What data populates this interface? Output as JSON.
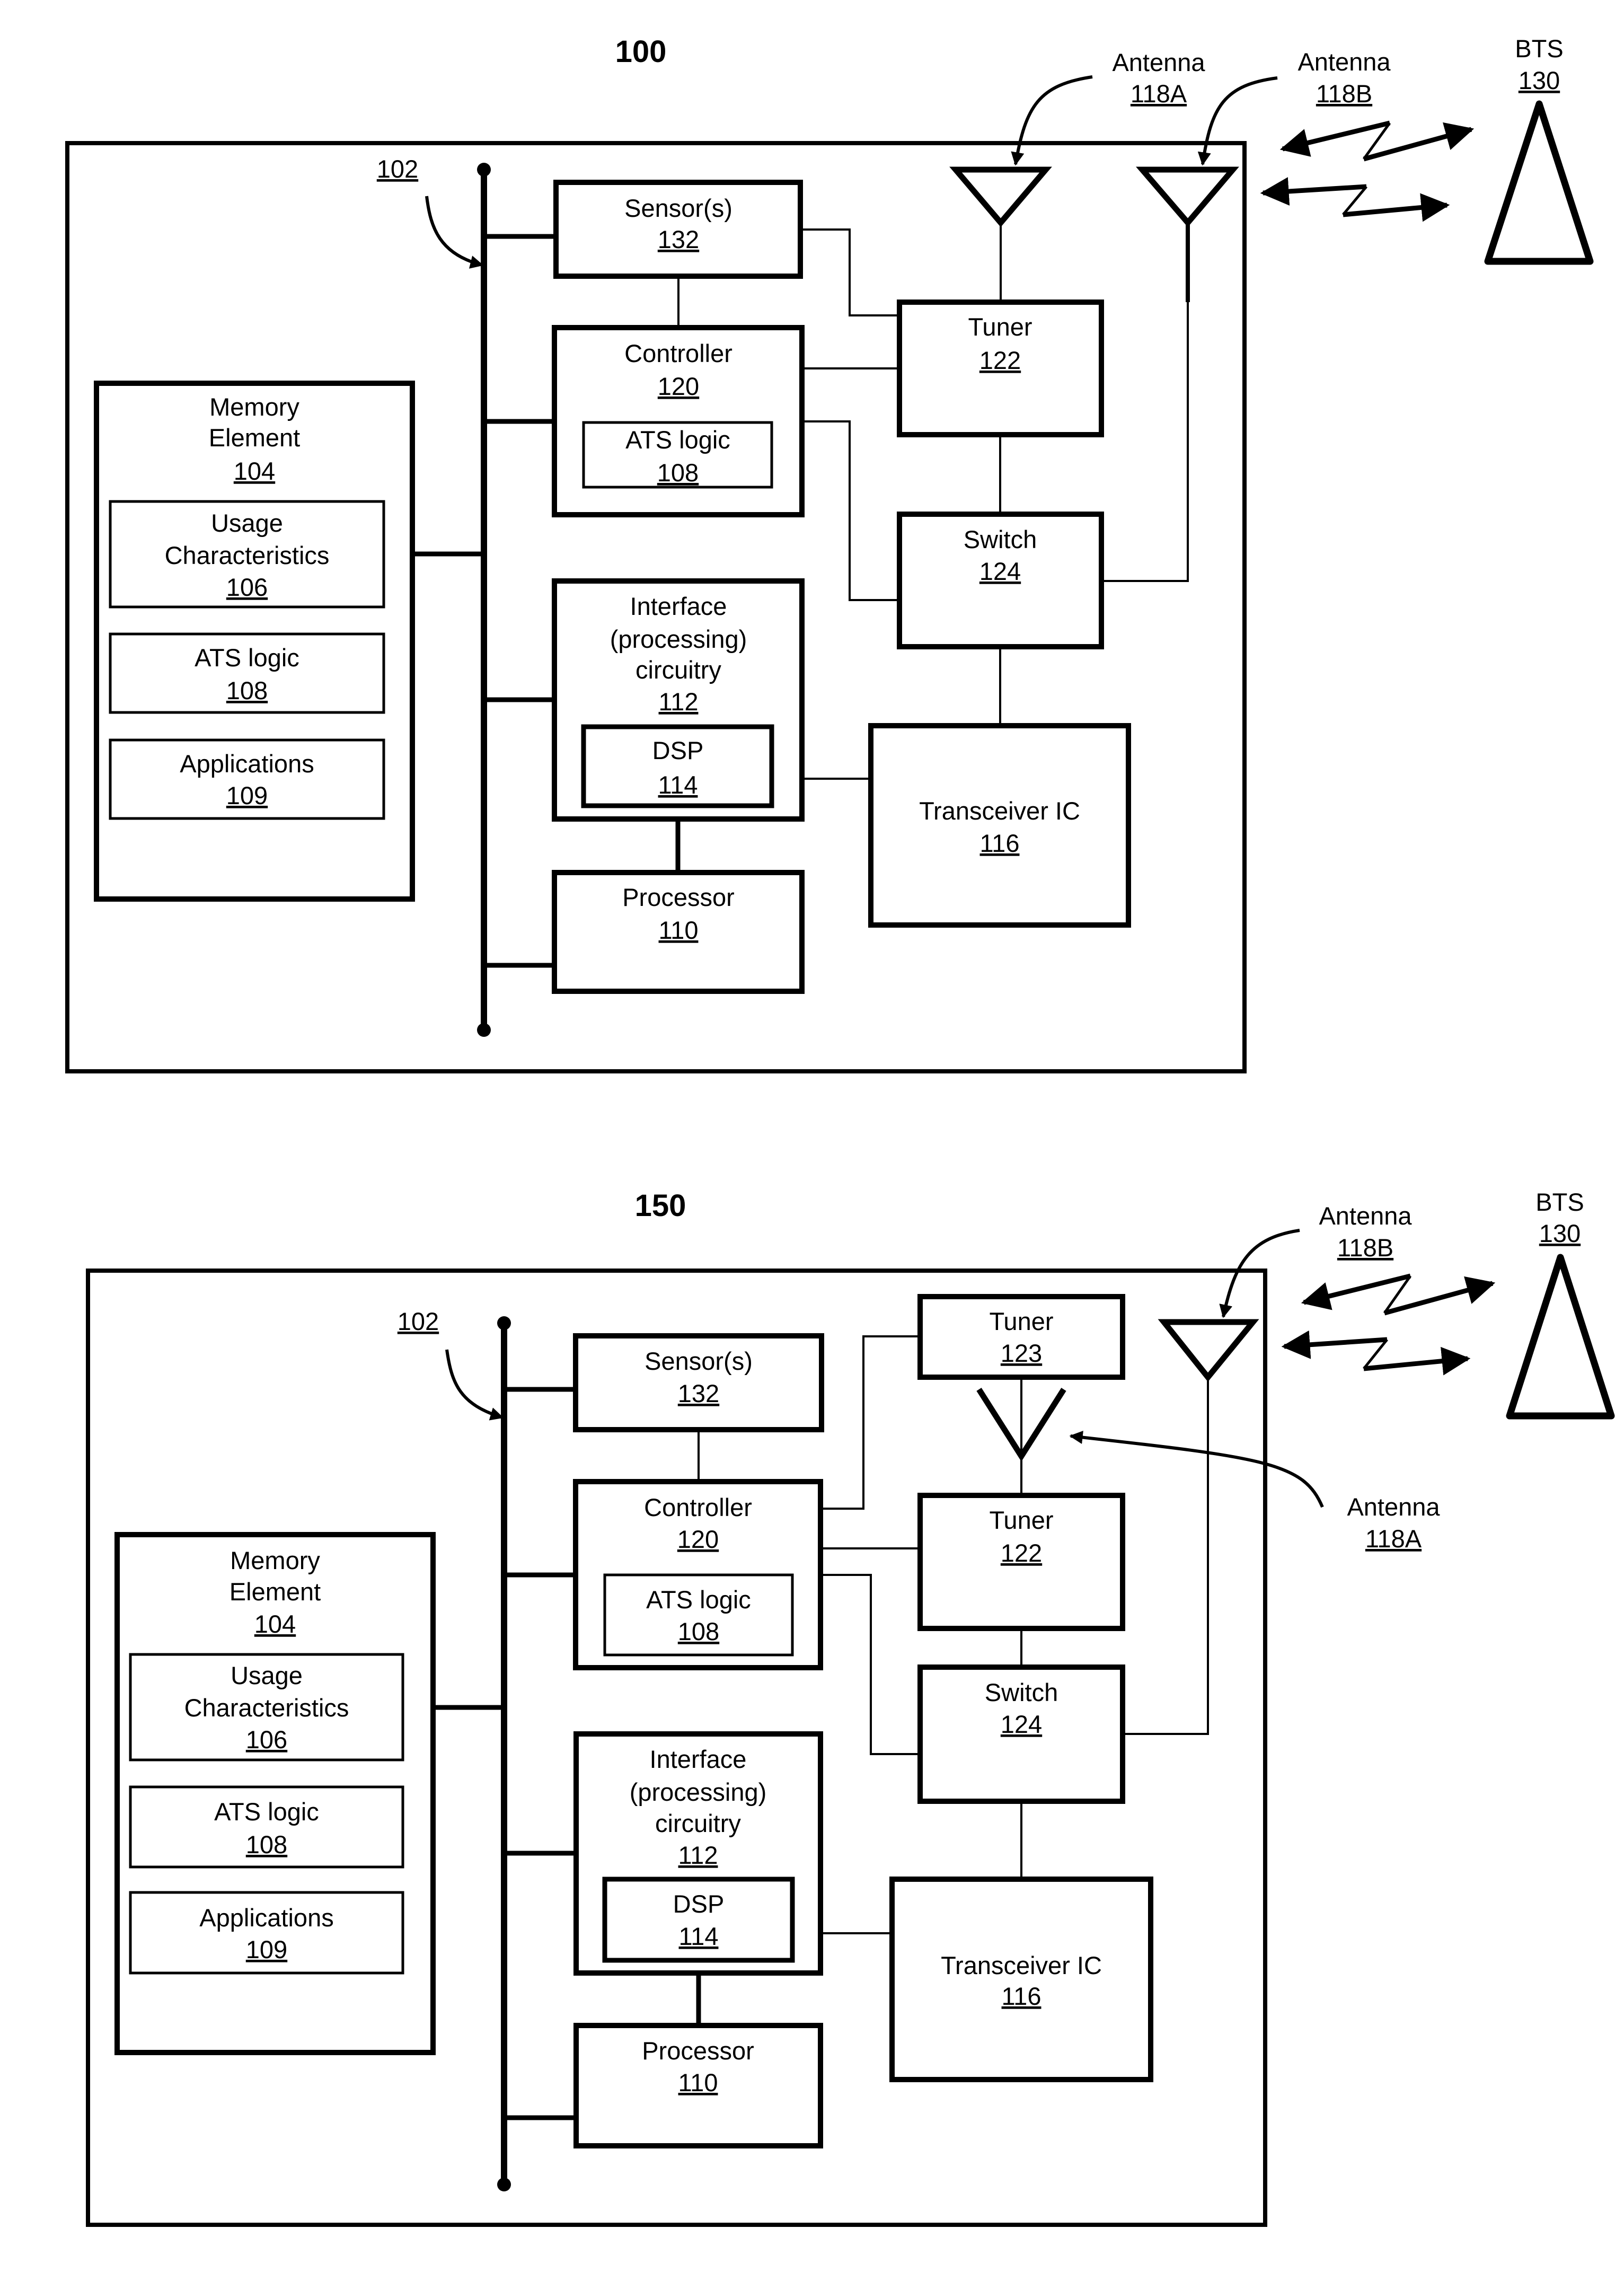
{
  "figures": [
    {
      "title": "100",
      "bus": {
        "ref": "102"
      },
      "blocks": {
        "sensor": {
          "lines": [
            "Sensor(s)"
          ],
          "ref": "132"
        },
        "controller": {
          "lines": [
            "Controller"
          ],
          "ref": "120"
        },
        "controller_ats": {
          "lines": [
            "ATS logic"
          ],
          "ref": "108"
        },
        "interface": {
          "lines": [
            "Interface",
            "(processing)",
            "circuitry"
          ],
          "ref": "112"
        },
        "dsp": {
          "lines": [
            "DSP"
          ],
          "ref": "114"
        },
        "processor": {
          "lines": [
            "Processor"
          ],
          "ref": "110"
        },
        "memory": {
          "lines": [
            "Memory",
            "Element"
          ],
          "ref": "104"
        },
        "usage": {
          "lines": [
            "Usage",
            "Characteristics"
          ],
          "ref": "106"
        },
        "memory_ats": {
          "lines": [
            "ATS logic"
          ],
          "ref": "108"
        },
        "applications": {
          "lines": [
            "Applications"
          ],
          "ref": "109"
        },
        "tuner_122": {
          "lines": [
            "Tuner"
          ],
          "ref": "122"
        },
        "switch": {
          "lines": [
            "Switch"
          ],
          "ref": "124"
        },
        "transceiver": {
          "lines": [
            "Transceiver IC"
          ],
          "ref": "116"
        }
      },
      "callouts": {
        "antenna_a": {
          "lines": [
            "Antenna"
          ],
          "ref": "118A"
        },
        "antenna_b": {
          "lines": [
            "Antenna"
          ],
          "ref": "118B"
        },
        "bts": {
          "lines": [
            "BTS"
          ],
          "ref": "130"
        }
      }
    },
    {
      "title": "150",
      "bus": {
        "ref": "102"
      },
      "blocks": {
        "sensor": {
          "lines": [
            "Sensor(s)"
          ],
          "ref": "132"
        },
        "controller": {
          "lines": [
            "Controller"
          ],
          "ref": "120"
        },
        "controller_ats": {
          "lines": [
            "ATS logic"
          ],
          "ref": "108"
        },
        "interface": {
          "lines": [
            "Interface",
            "(processing)",
            "circuitry"
          ],
          "ref": "112"
        },
        "dsp": {
          "lines": [
            "DSP"
          ],
          "ref": "114"
        },
        "processor": {
          "lines": [
            "Processor"
          ],
          "ref": "110"
        },
        "memory": {
          "lines": [
            "Memory",
            "Element"
          ],
          "ref": "104"
        },
        "usage": {
          "lines": [
            "Usage",
            "Characteristics"
          ],
          "ref": "106"
        },
        "memory_ats": {
          "lines": [
            "ATS logic"
          ],
          "ref": "108"
        },
        "applications": {
          "lines": [
            "Applications"
          ],
          "ref": "109"
        },
        "tuner_123": {
          "lines": [
            "Tuner"
          ],
          "ref": "123"
        },
        "tuner_122": {
          "lines": [
            "Tuner"
          ],
          "ref": "122"
        },
        "switch": {
          "lines": [
            "Switch"
          ],
          "ref": "124"
        },
        "transceiver": {
          "lines": [
            "Transceiver IC"
          ],
          "ref": "116"
        }
      },
      "callouts": {
        "antenna_a": {
          "lines": [
            "Antenna"
          ],
          "ref": "118A"
        },
        "antenna_b": {
          "lines": [
            "Antenna"
          ],
          "ref": "118B"
        },
        "bts": {
          "lines": [
            "BTS"
          ],
          "ref": "130"
        }
      }
    }
  ]
}
